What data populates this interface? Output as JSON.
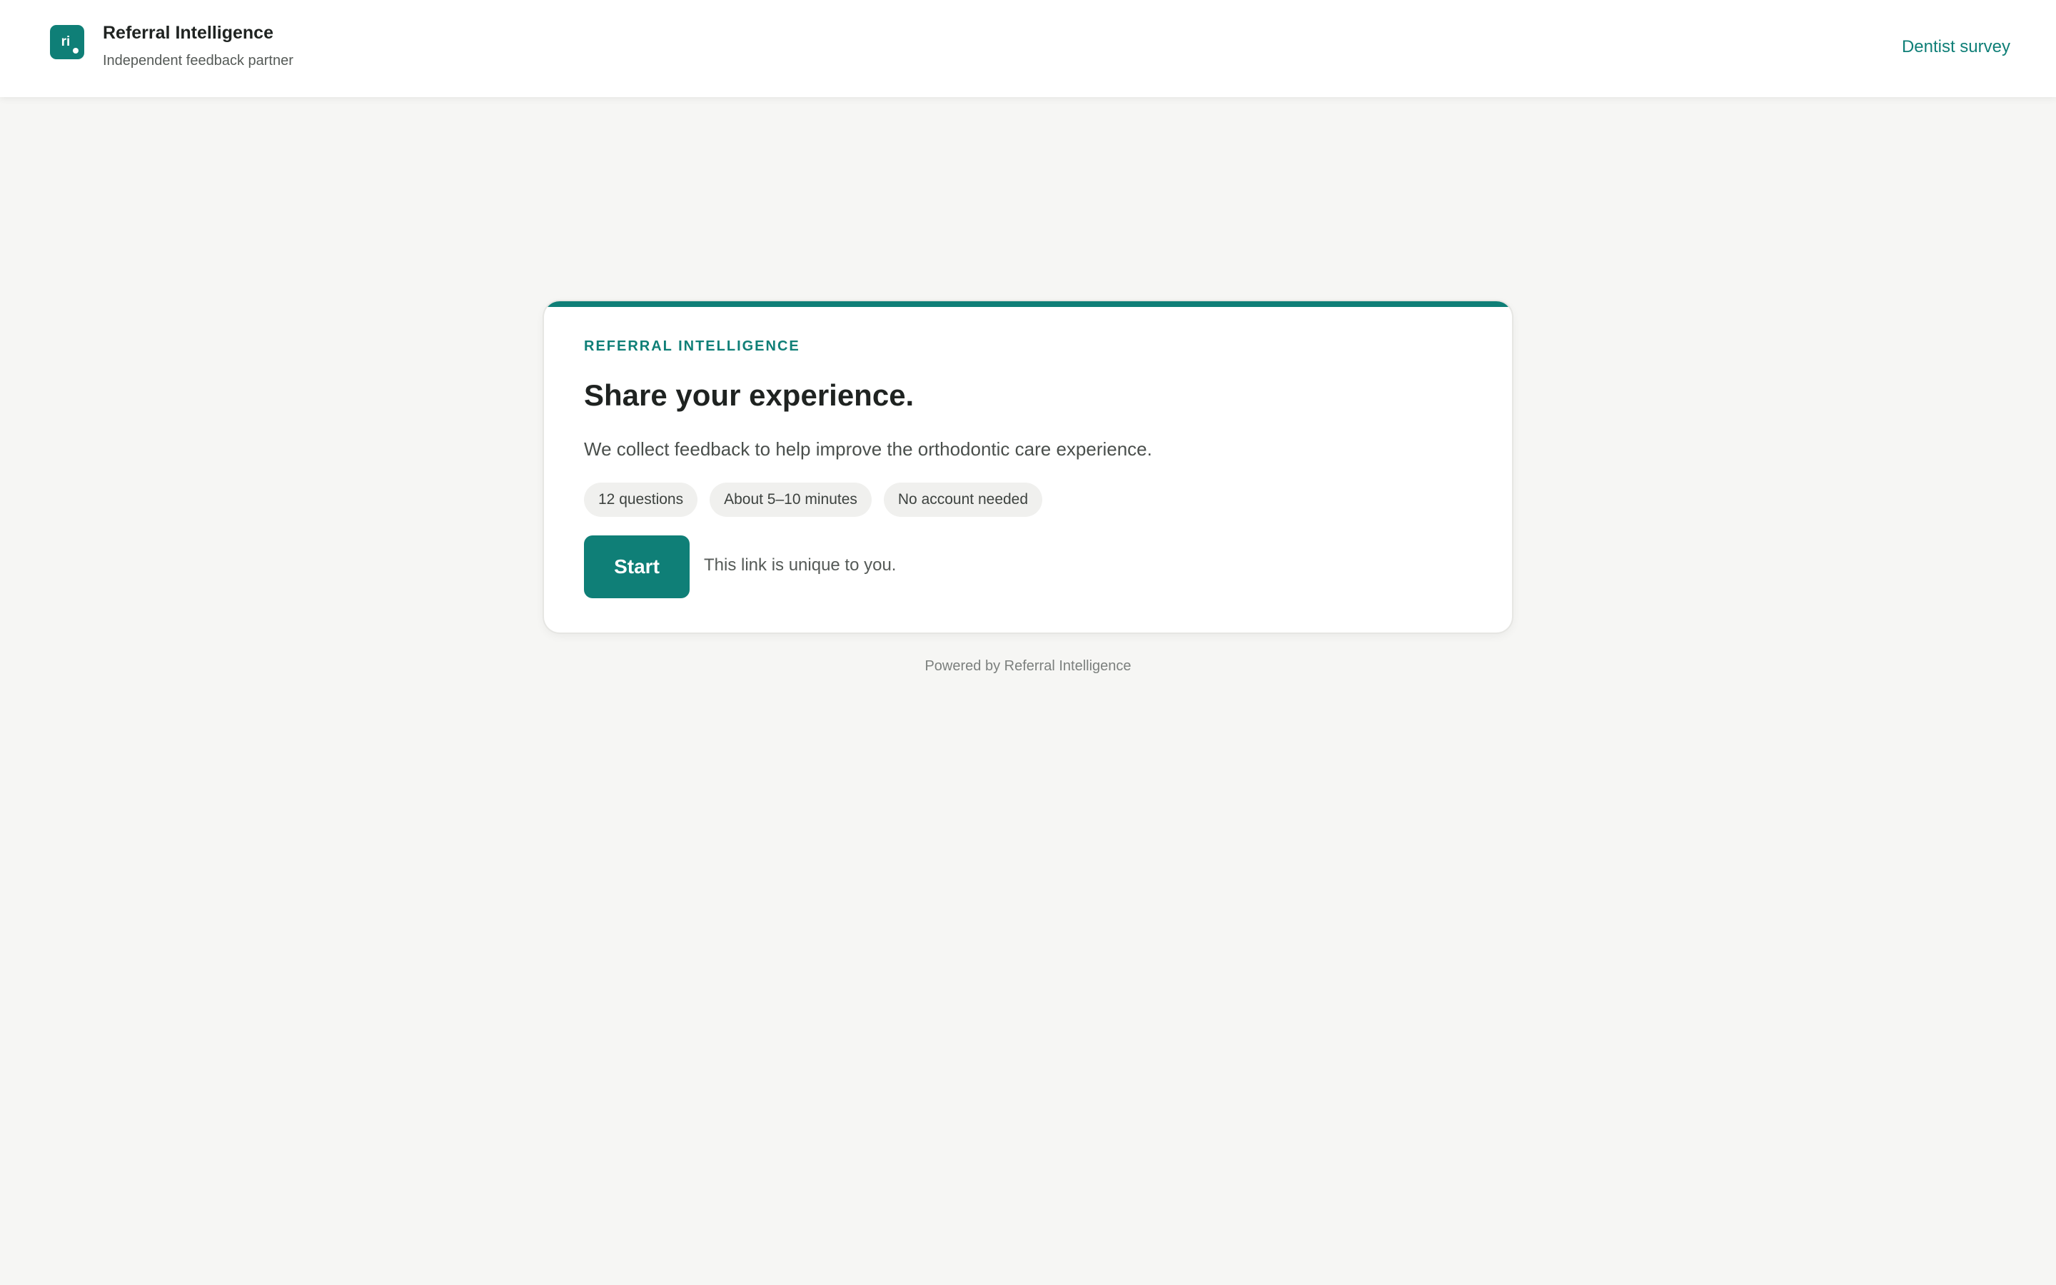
{
  "colors": {
    "accent": "#0f7f77",
    "background": "#f6f6f4",
    "card": "#ffffff",
    "pill": "#f0f0ee"
  },
  "header": {
    "logo_text": "ri",
    "logo_icon": "brand-logo-icon",
    "brand_name": "Referral Intelligence",
    "tagline": "Independent feedback partner",
    "link_label": "Dentist survey"
  },
  "card": {
    "eyebrow": "REFERRAL INTELLIGENCE",
    "title": "Share your experience.",
    "description": "We collect feedback to help improve the orthodontic care experience.",
    "pills": [
      "12 questions",
      "About 5–10 minutes",
      "No account needed"
    ],
    "start_label": "Start",
    "start_note": "This link is unique to you."
  },
  "footer": {
    "text": "Powered by Referral Intelligence"
  }
}
